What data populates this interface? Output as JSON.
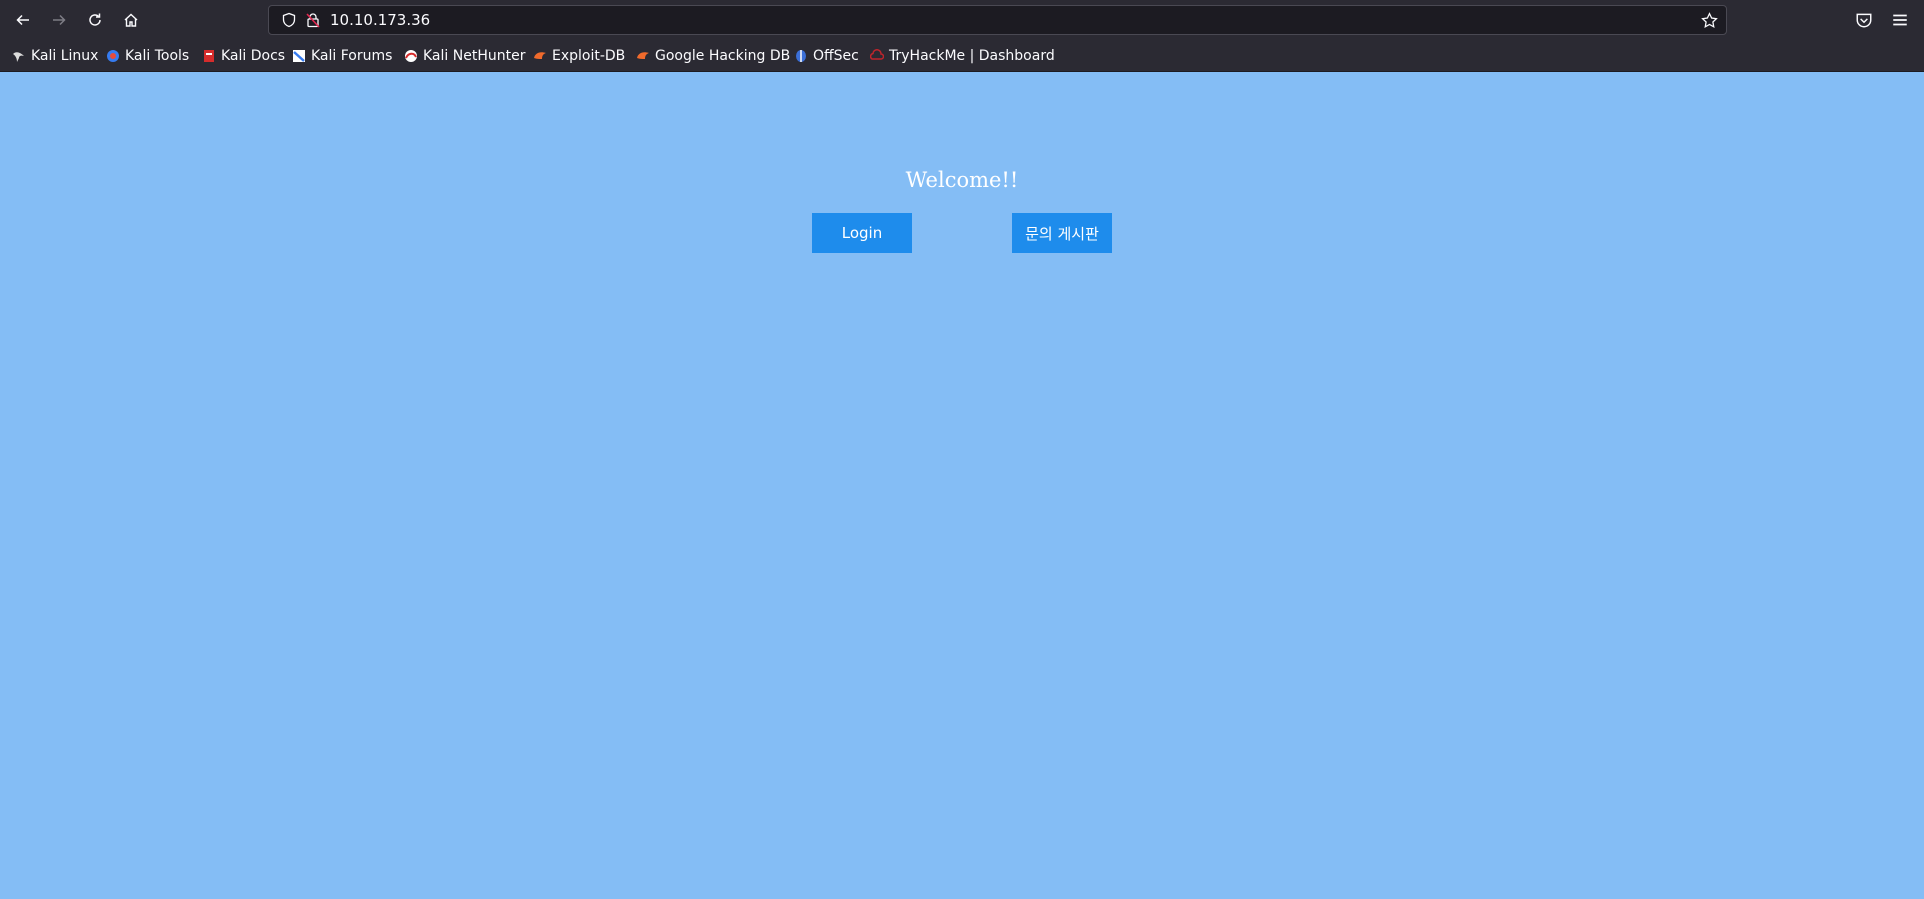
{
  "browser": {
    "url": "10.10.173.36",
    "bookmarks": [
      {
        "label": "Kali Linux",
        "icon": "kali-dragon-icon"
      },
      {
        "label": "Kali Tools",
        "icon": "kali-tools-icon"
      },
      {
        "label": "Kali Docs",
        "icon": "kali-docs-icon"
      },
      {
        "label": "Kali Forums",
        "icon": "kali-forums-icon"
      },
      {
        "label": "Kali NetHunter",
        "icon": "nethunter-icon"
      },
      {
        "label": "Exploit-DB",
        "icon": "exploit-db-icon"
      },
      {
        "label": "Google Hacking DB",
        "icon": "ghdb-icon"
      },
      {
        "label": "OffSec",
        "icon": "offsec-icon"
      },
      {
        "label": "TryHackMe | Dashboard",
        "icon": "tryhackme-icon"
      }
    ]
  },
  "page": {
    "welcome": "Welcome!!",
    "login_label": "Login",
    "board_label": "문의 게시판",
    "background_color": "#84bdf5",
    "button_color": "#1e8cec"
  }
}
